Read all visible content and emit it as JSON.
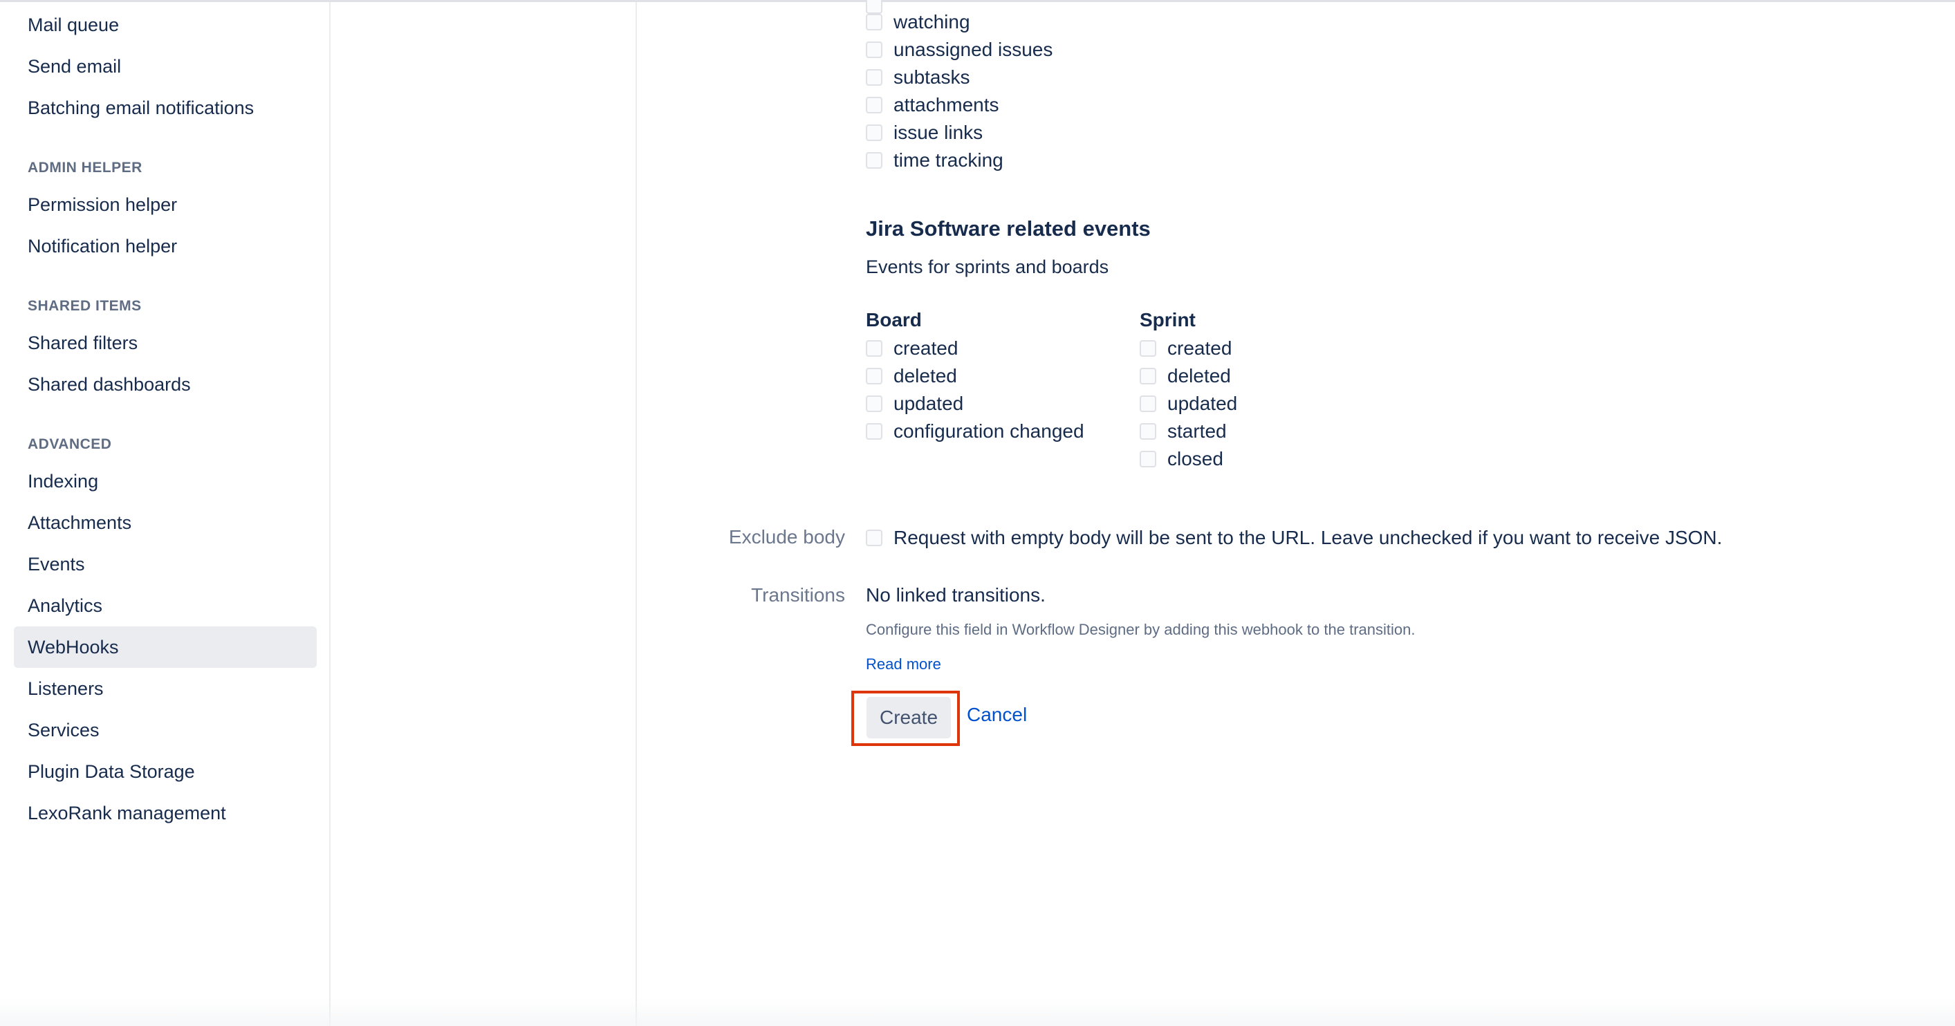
{
  "sidebar": {
    "items_top": [
      {
        "label": "Mail queue"
      },
      {
        "label": "Send email"
      },
      {
        "label": "Batching email notifications"
      }
    ],
    "sections": [
      {
        "heading": "ADMIN HELPER",
        "items": [
          {
            "label": "Permission helper"
          },
          {
            "label": "Notification helper"
          }
        ]
      },
      {
        "heading": "SHARED ITEMS",
        "items": [
          {
            "label": "Shared filters"
          },
          {
            "label": "Shared dashboards"
          }
        ]
      },
      {
        "heading": "ADVANCED",
        "items": [
          {
            "label": "Indexing"
          },
          {
            "label": "Attachments"
          },
          {
            "label": "Events"
          },
          {
            "label": "Analytics"
          },
          {
            "label": "WebHooks",
            "active": true
          },
          {
            "label": "Listeners"
          },
          {
            "label": "Services"
          },
          {
            "label": "Plugin Data Storage"
          },
          {
            "label": "LexoRank management"
          }
        ]
      }
    ]
  },
  "issue_events": [
    {
      "label": "watching"
    },
    {
      "label": "unassigned issues"
    },
    {
      "label": "subtasks"
    },
    {
      "label": "attachments"
    },
    {
      "label": "issue links"
    },
    {
      "label": "time tracking"
    }
  ],
  "software_events": {
    "title": "Jira Software related events",
    "description": "Events for sprints and boards",
    "board": {
      "heading": "Board",
      "items": [
        "created",
        "deleted",
        "updated",
        "configuration changed"
      ]
    },
    "sprint": {
      "heading": "Sprint",
      "items": [
        "created",
        "deleted",
        "updated",
        "started",
        "closed"
      ]
    }
  },
  "exclude_body": {
    "label": "Exclude body",
    "text": "Request with empty body will be sent to the URL. Leave unchecked if you want to receive JSON."
  },
  "transitions": {
    "label": "Transitions",
    "value": "No linked transitions.",
    "hint": "Configure this field in Workflow Designer by adding this webhook to the transition.",
    "read_more": "Read more"
  },
  "actions": {
    "create": "Create",
    "cancel": "Cancel"
  },
  "colors": {
    "highlight": "#de350b",
    "link": "#0052cc",
    "active_nav_bg": "#ebecf0"
  }
}
